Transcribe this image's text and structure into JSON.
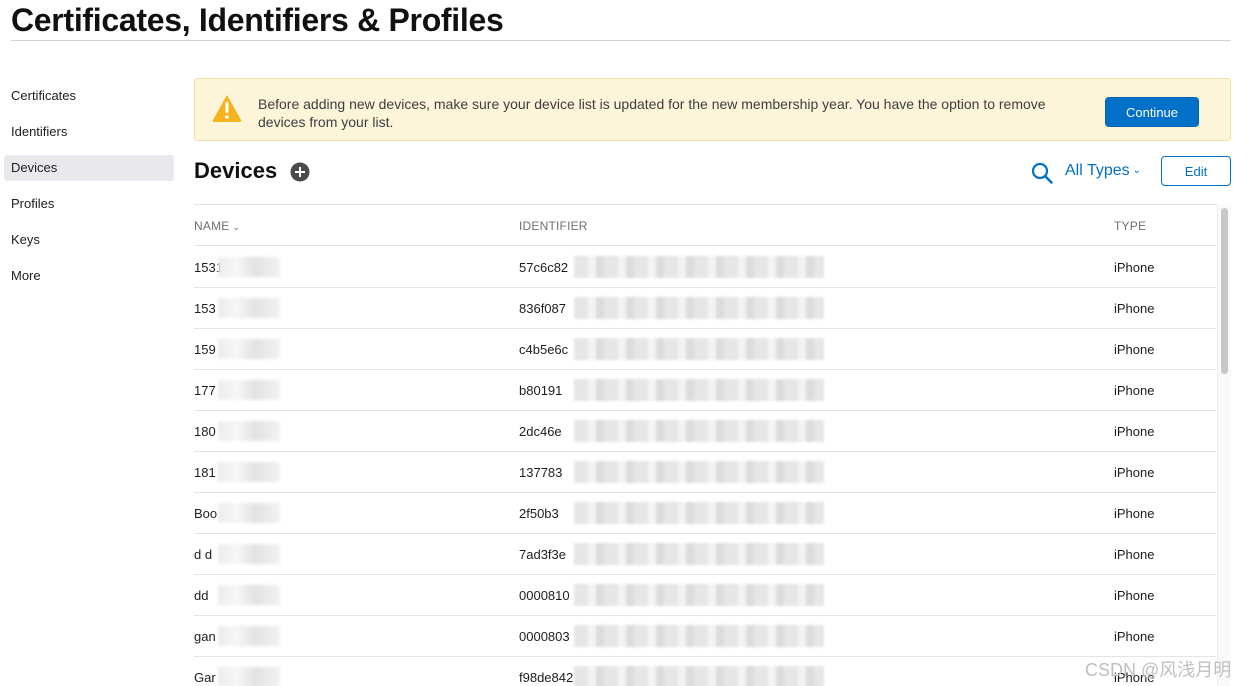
{
  "page": {
    "title": "Certificates, Identifiers & Profiles"
  },
  "sidebar": {
    "items": [
      {
        "label": "Certificates"
      },
      {
        "label": "Identifiers"
      },
      {
        "label": "Devices"
      },
      {
        "label": "Profiles"
      },
      {
        "label": "Keys"
      },
      {
        "label": "More"
      }
    ],
    "active": "Devices"
  },
  "banner": {
    "text": "Before adding new devices, make sure your device list is updated for the new membership year. You have the option to remove devices from your list.",
    "button_label": "Continue",
    "icon": "warning-triangle-icon",
    "icon_color": "#f5b31d"
  },
  "devices": {
    "title": "Devices",
    "filter_label": "All Types",
    "edit_label": "Edit",
    "columns": {
      "name": "NAME",
      "identifier": "IDENTIFIER",
      "type": "TYPE"
    },
    "rows": [
      {
        "name": "1531",
        "identifier": "57c6c82",
        "type": "iPhone"
      },
      {
        "name": "153",
        "identifier": "836f087",
        "type": "iPhone"
      },
      {
        "name": "159",
        "identifier": "c4b5e6c",
        "type": "iPhone"
      },
      {
        "name": "177",
        "identifier": "b80191",
        "type": "iPhone"
      },
      {
        "name": "180",
        "identifier": "2dc46e",
        "type": "iPhone"
      },
      {
        "name": "181",
        "identifier": "137783",
        "type": "iPhone"
      },
      {
        "name": "Boo",
        "identifier": "2f50b3",
        "type": "iPhone"
      },
      {
        "name": "d d",
        "identifier": "7ad3f3e",
        "type": "iPhone"
      },
      {
        "name": "dd",
        "identifier": "0000810",
        "type": "iPhone"
      },
      {
        "name": "gan",
        "identifier": "0000803",
        "type": "iPhone"
      },
      {
        "name": "Gar",
        "identifier": "f98de842",
        "type": "iPhone"
      }
    ]
  },
  "watermark": "CSDN @风浅月明",
  "colors": {
    "accent": "#0070c9",
    "banner_bg": "#fdf5d9",
    "active_nav": "#e8e8ed"
  }
}
